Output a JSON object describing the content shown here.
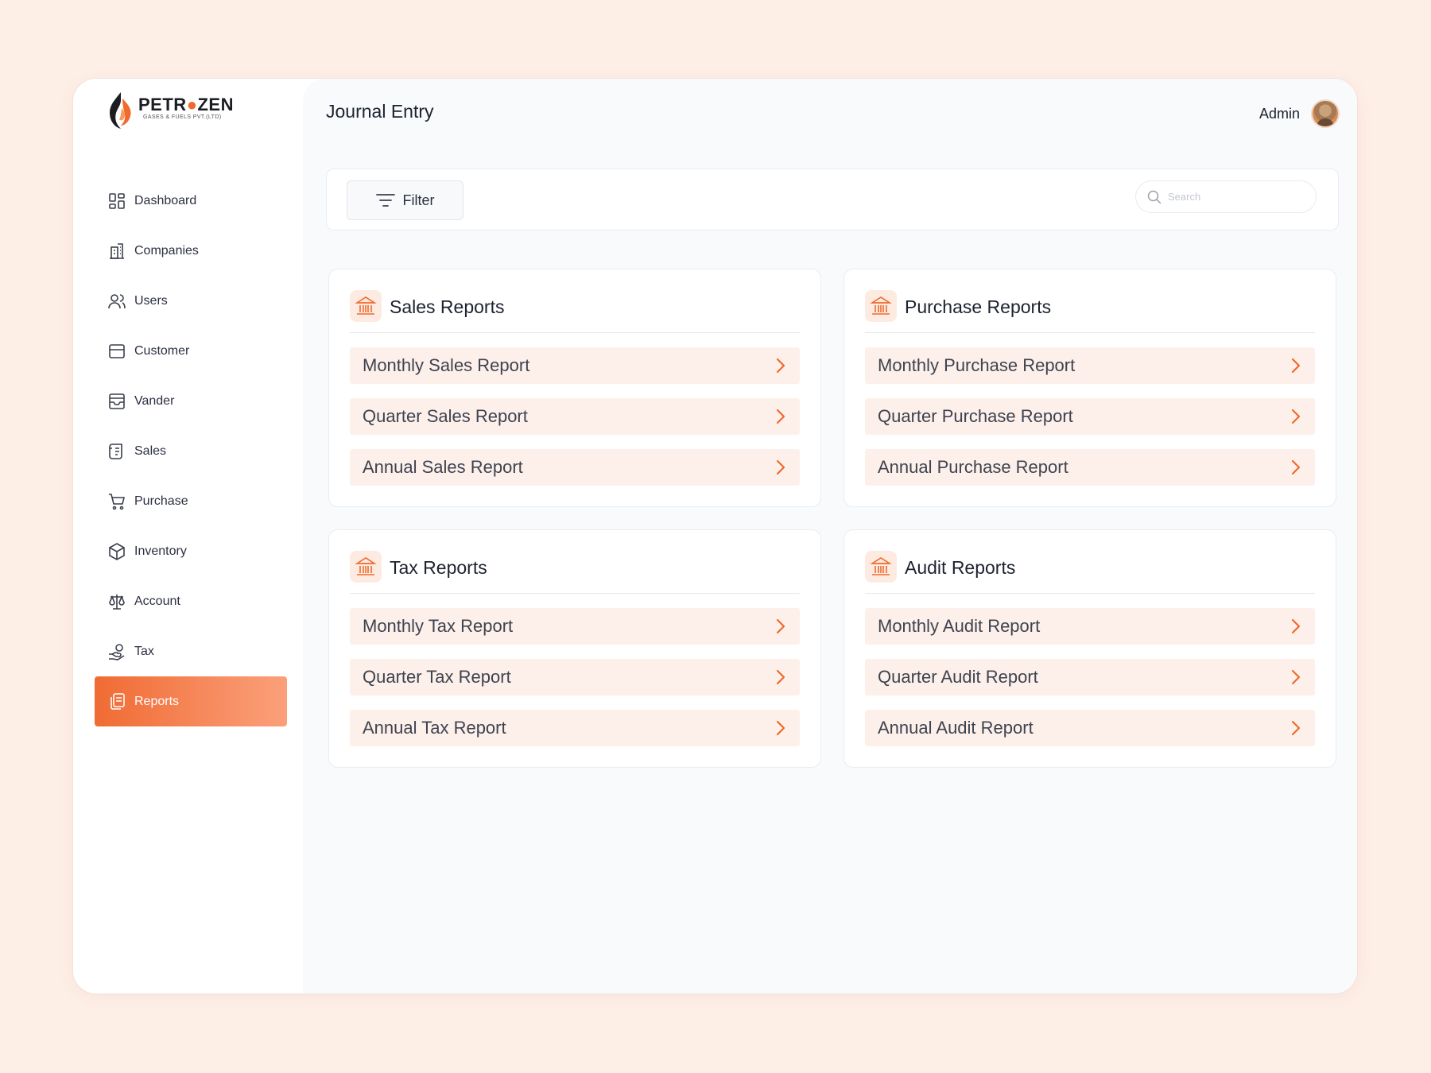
{
  "brand": {
    "name_part1": "PETR",
    "name_part2": "ZEN",
    "tagline": "GASES & FUELS PVT.(LTD)"
  },
  "sidebar": {
    "items": [
      {
        "label": "Dashboard",
        "icon": "dashboard-icon"
      },
      {
        "label": "Companies",
        "icon": "building-icon"
      },
      {
        "label": "Users",
        "icon": "users-icon"
      },
      {
        "label": "Customer",
        "icon": "briefcase-icon"
      },
      {
        "label": "Vander",
        "icon": "inbox-icon"
      },
      {
        "label": "Sales",
        "icon": "scroll-icon"
      },
      {
        "label": "Purchase",
        "icon": "cart-icon"
      },
      {
        "label": "Inventory",
        "icon": "box-icon"
      },
      {
        "label": "Account",
        "icon": "scale-icon"
      },
      {
        "label": "Tax",
        "icon": "hand-coin-icon"
      },
      {
        "label": "Reports",
        "icon": "reports-icon",
        "active": true
      }
    ]
  },
  "header": {
    "title": "Journal Entry",
    "user_name": "Admin"
  },
  "toolbar": {
    "filter_label": "Filter",
    "search_placeholder": "Search"
  },
  "reports": {
    "sales": {
      "title": "Sales Reports",
      "items": [
        "Monthly Sales Report",
        "Quarter Sales Report",
        "Annual Sales Report"
      ]
    },
    "purchase": {
      "title": "Purchase Reports",
      "items": [
        "Monthly Purchase Report",
        "Quarter Purchase Report",
        "Annual Purchase Report"
      ]
    },
    "tax": {
      "title": "Tax Reports",
      "items": [
        "Monthly Tax Report",
        "Quarter Tax Report",
        "Annual Tax Report"
      ]
    },
    "audit": {
      "title": "Audit Reports",
      "items": [
        "Monthly Audit Report",
        "Quarter Audit Report",
        "Annual Audit Report"
      ]
    }
  },
  "colors": {
    "accent": "#f06b33",
    "accent_light": "#fba07b",
    "row_bg": "#fdf0ea",
    "page_bg": "#fdeee6"
  }
}
